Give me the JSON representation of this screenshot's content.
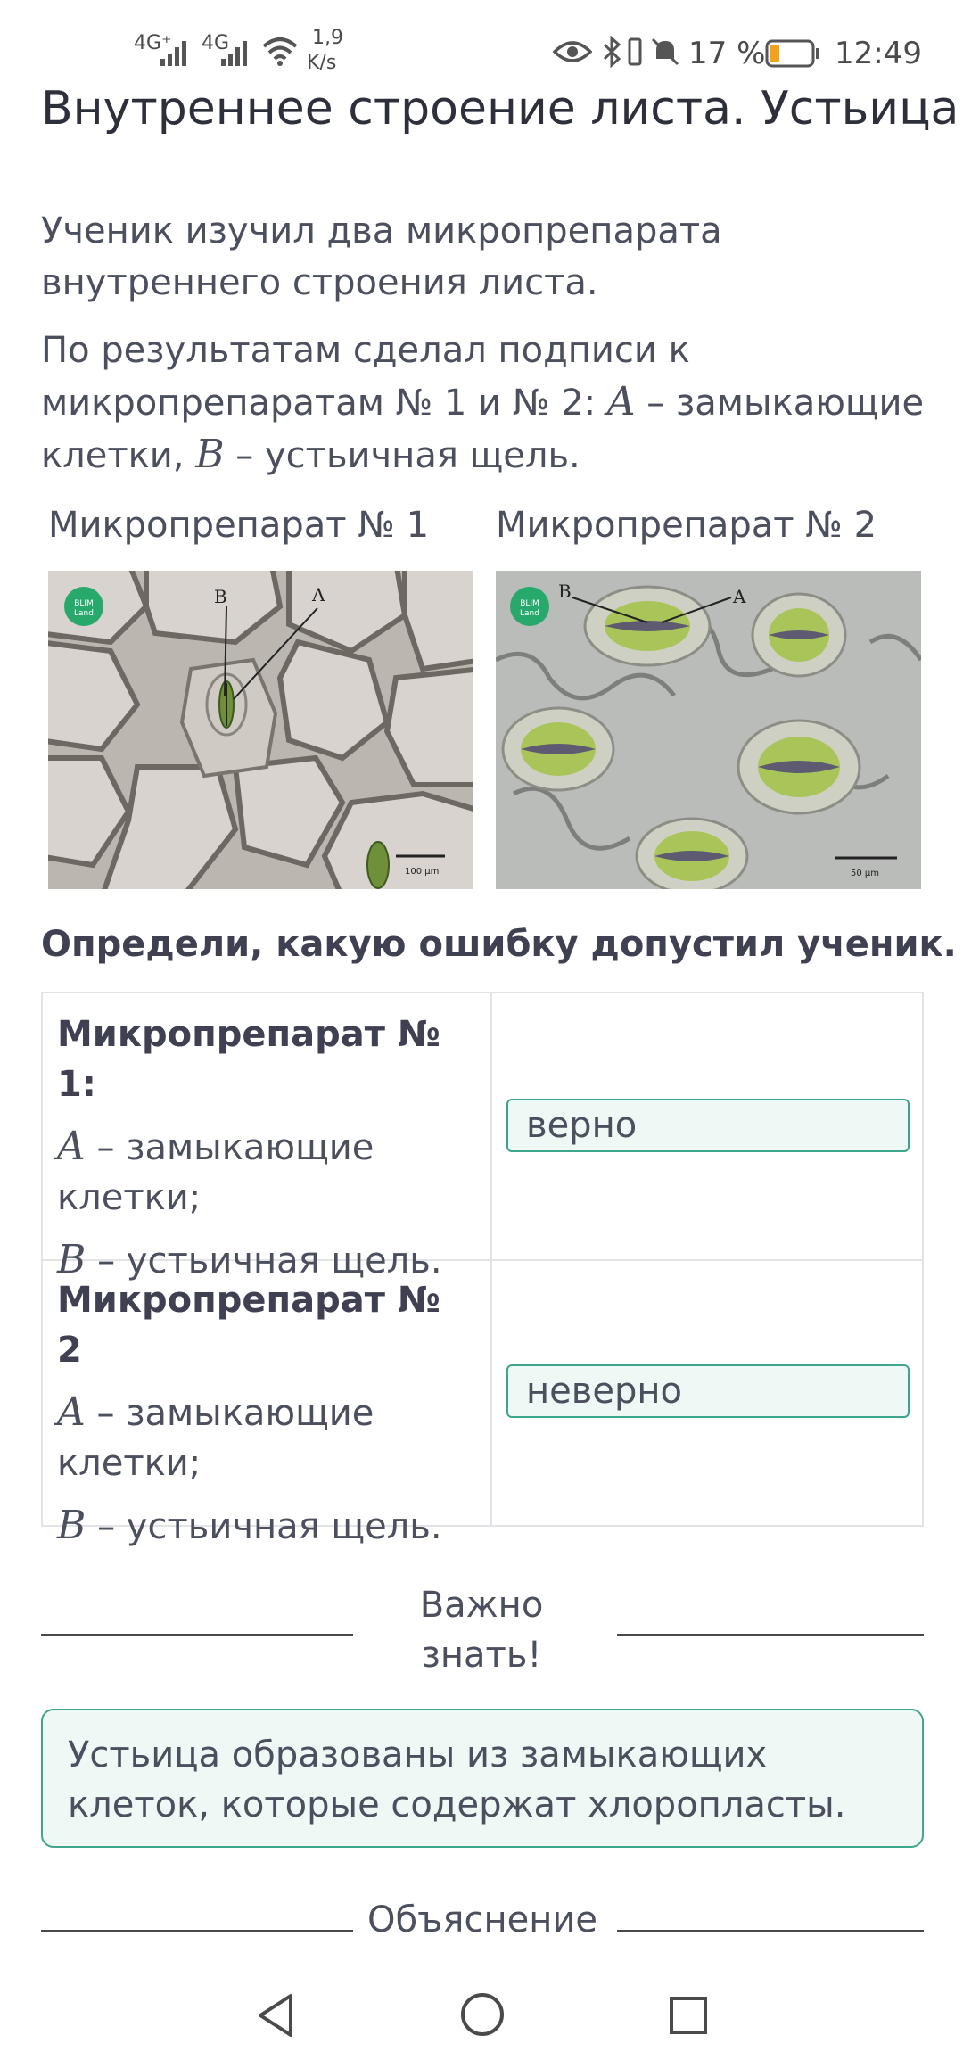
{
  "status_bar": {
    "signal1": "4G⁺",
    "signal2": "4G",
    "speed_value": "1,9",
    "speed_unit": "K/s",
    "battery": "17 %",
    "time": "12:49"
  },
  "page": {
    "title": "Внутреннее строение листа. Устьица",
    "intro": "Ученик изучил два микропрепарата внутреннего строения листа.",
    "notes_prefix": "По результатам сделал подписи к микропрепаратам № 1 и № 2:",
    "var_a": "A",
    "var_b": "B",
    "def_a": "– замыкающие клетки,",
    "def_b": "– устьичная щель."
  },
  "specimens": [
    {
      "label": "Микропрепарат № 1",
      "badge_line1": "BLIM",
      "badge_line2": "Land",
      "label_a": "A",
      "label_b": "B",
      "scale": "100 μm"
    },
    {
      "label": "Микропрепарат № 2",
      "badge_line1": "BLIM",
      "badge_line2": "Land",
      "label_a": "A",
      "label_b": "B",
      "scale": "50 μm"
    }
  ],
  "question": "Определи, какую ошибку допустил ученик.",
  "table": {
    "rows": [
      {
        "header": "Микропрепарат № 1:",
        "var_a": "A",
        "text_a1": "– замыкающие",
        "text_a2": "клетки;",
        "var_b": "B",
        "text_b": "– устьичная щель.",
        "answer": "верно"
      },
      {
        "header": "Микропрепарат № 2",
        "var_a": "A",
        "text_a1": "– замыкающие",
        "text_a2": "клетки;",
        "var_b": "B",
        "text_b": "– устьичная щель.",
        "answer": "неверно"
      }
    ]
  },
  "important": {
    "line1": "Важно",
    "line2": "знать!"
  },
  "info": "Устьица образованы из замыкающих клеток, которые содержат хлоропласты.",
  "explanation": "Объяснение",
  "nav_icons": [
    "back-icon",
    "home-icon",
    "recents-icon"
  ],
  "colors": {
    "accent": "#3fa58c",
    "answer_bg": "#eef8f4",
    "badge": "#27a96b"
  }
}
